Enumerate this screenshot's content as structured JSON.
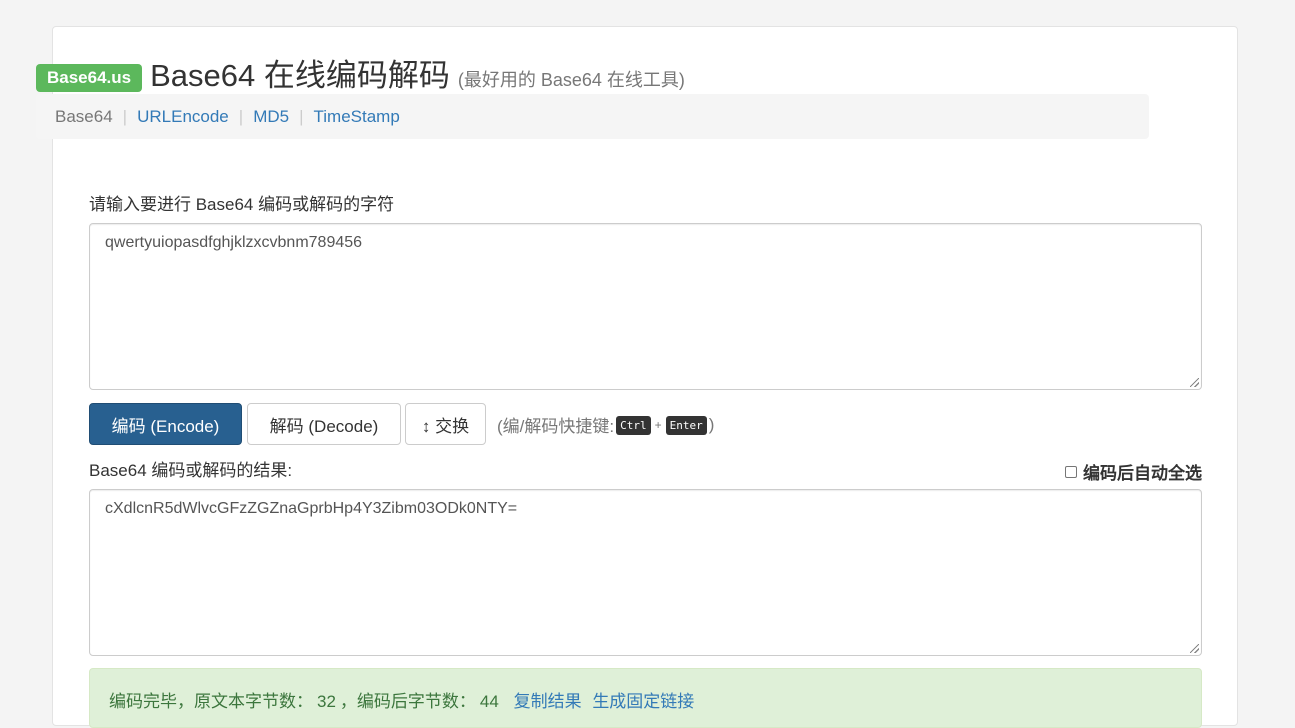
{
  "header": {
    "brand": "Base64.us",
    "title": "Base64 在线编码解码",
    "subtitle": "(最好用的 Base64 在线工具)"
  },
  "nav": {
    "items": [
      {
        "label": "Base64",
        "active": true
      },
      {
        "label": "URLEncode",
        "active": false
      },
      {
        "label": "MD5",
        "active": false
      },
      {
        "label": "TimeStamp",
        "active": false
      }
    ],
    "separator": "|"
  },
  "input": {
    "label": "请输入要进行 Base64 编码或解码的字符",
    "value": "qwertyuiopasdfghjklzxcvbnm789456"
  },
  "buttons": {
    "encode": "编码 (Encode)",
    "decode": "解码 (Decode)",
    "swap": "↕ 交换"
  },
  "shortcut": {
    "prefix": "(编/解码快捷键:",
    "key1": "Ctrl",
    "plus": "+",
    "key2": "Enter",
    "suffix": ")"
  },
  "output": {
    "label": "Base64 编码或解码的结果:",
    "auto_select_label": "编码后自动全选",
    "value": "cXdlcnR5dWlvcGFzZGZnaGprbHp4Y3Zibm03ODk0NTY="
  },
  "status": {
    "text1": "编码完毕，原文本字节数：",
    "orig_bytes": "32",
    "text2": "，编码后字节数：",
    "enc_bytes": "44",
    "copy_link": "复制结果",
    "permalink": "生成固定链接"
  },
  "colors": {
    "brand": "#5cb85c",
    "primary": "#286090",
    "link": "#337ab7",
    "success_bg": "#dff0d8"
  }
}
